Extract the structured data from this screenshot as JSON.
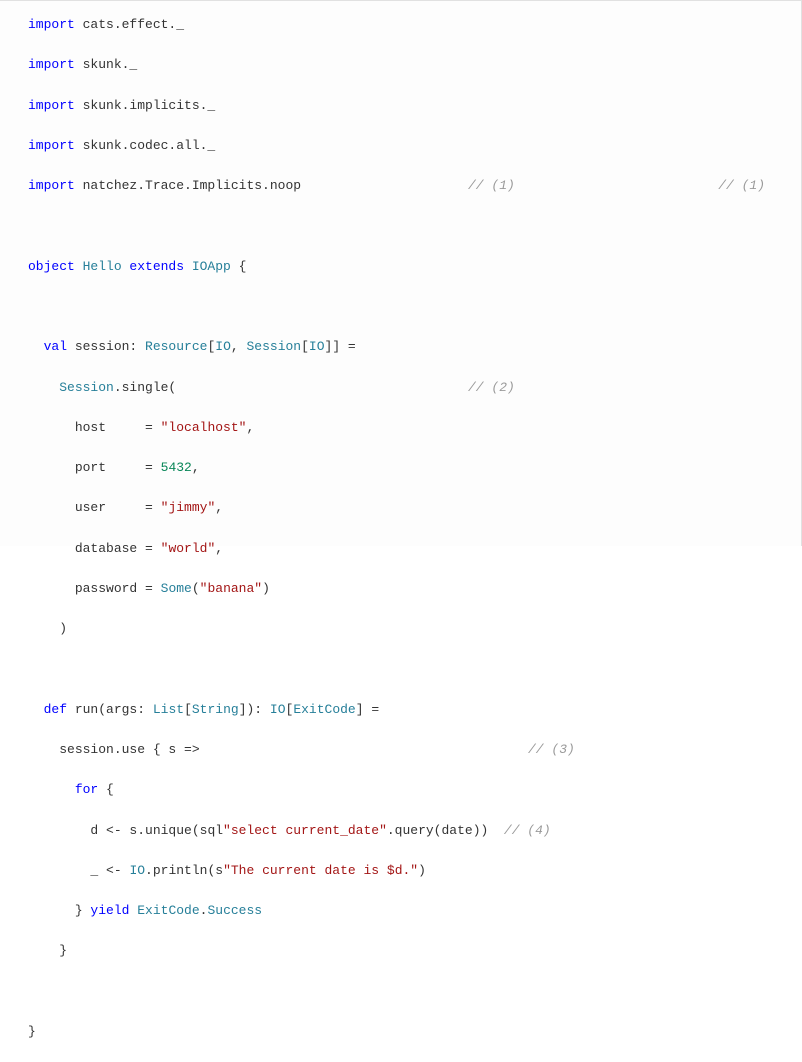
{
  "code": {
    "l1_kw": "import",
    "l1_rest": " cats.effect._",
    "l2_kw": "import",
    "l2_rest": " skunk._",
    "l3_kw": "import",
    "l3_rest": " skunk.implicits._",
    "l4_kw": "import",
    "l4_rest": " skunk.codec.all._",
    "l5_kw": "import",
    "l5_rest": " natchez.Trace.Implicits.noop",
    "l5_annot_mid": "// (1)",
    "l5_annot_right": "// (1)",
    "l6": "",
    "l7_kw": "object",
    "l7_name": " Hello ",
    "l7_kw2": "extends",
    "l7_type": " IOApp",
    "l7_brace": " {",
    "l8": "",
    "l9_indent": "  ",
    "l9_kw": "val",
    "l9_name": " session: ",
    "l9_type1": "Resource",
    "l9_b1": "[",
    "l9_type2": "IO",
    "l9_b2": ", ",
    "l9_type3": "Session",
    "l9_b3": "[",
    "l9_type4": "IO",
    "l9_b4": "]] =",
    "l10_indent": "    ",
    "l10_type": "Session",
    "l10_rest": ".single(",
    "l10_annot": "// (2)",
    "l11_indent": "      ",
    "l11_label": "host     = ",
    "l11_str": "\"localhost\"",
    "l11_comma": ",",
    "l12_indent": "      ",
    "l12_label": "port     = ",
    "l12_num": "5432",
    "l12_comma": ",",
    "l13_indent": "      ",
    "l13_label": "user     = ",
    "l13_str": "\"jimmy\"",
    "l13_comma": ",",
    "l14_indent": "      ",
    "l14_label": "database = ",
    "l14_str": "\"world\"",
    "l14_comma": ",",
    "l15_indent": "      ",
    "l15_label": "password = ",
    "l15_type": "Some",
    "l15_p1": "(",
    "l15_str": "\"banana\"",
    "l15_p2": ")",
    "l16": "    )",
    "l17": "",
    "l18_indent": "  ",
    "l18_kw": "def",
    "l18_name": " run(args: ",
    "l18_type1": "List",
    "l18_b1": "[",
    "l18_type2": "String",
    "l18_b2": "]): ",
    "l18_type3": "IO",
    "l18_b3": "[",
    "l18_type4": "ExitCode",
    "l18_b4": "] =",
    "l19_indent": "    ",
    "l19_text": "session.use { s =>",
    "l19_annot": "// (3)",
    "l20_indent": "      ",
    "l20_kw": "for",
    "l20_rest": " {",
    "l21_indent": "        ",
    "l21_text": "d <- s.unique(sql",
    "l21_str": "\"select current_date\"",
    "l21_text2": ".query(date))  ",
    "l21_annot": "// (4)",
    "l22_indent": "        ",
    "l22_text": "_ <- ",
    "l22_type": "IO",
    "l22_text2": ".println(s",
    "l22_str": "\"The current date is $d.\"",
    "l22_text3": ")",
    "l23_indent": "      ",
    "l23_text": "} ",
    "l23_kw": "yield",
    "l23_type": " ExitCode",
    "l23_text2": ".",
    "l23_type2": "Success",
    "l24": "    }",
    "l25": "",
    "l26": "}"
  }
}
